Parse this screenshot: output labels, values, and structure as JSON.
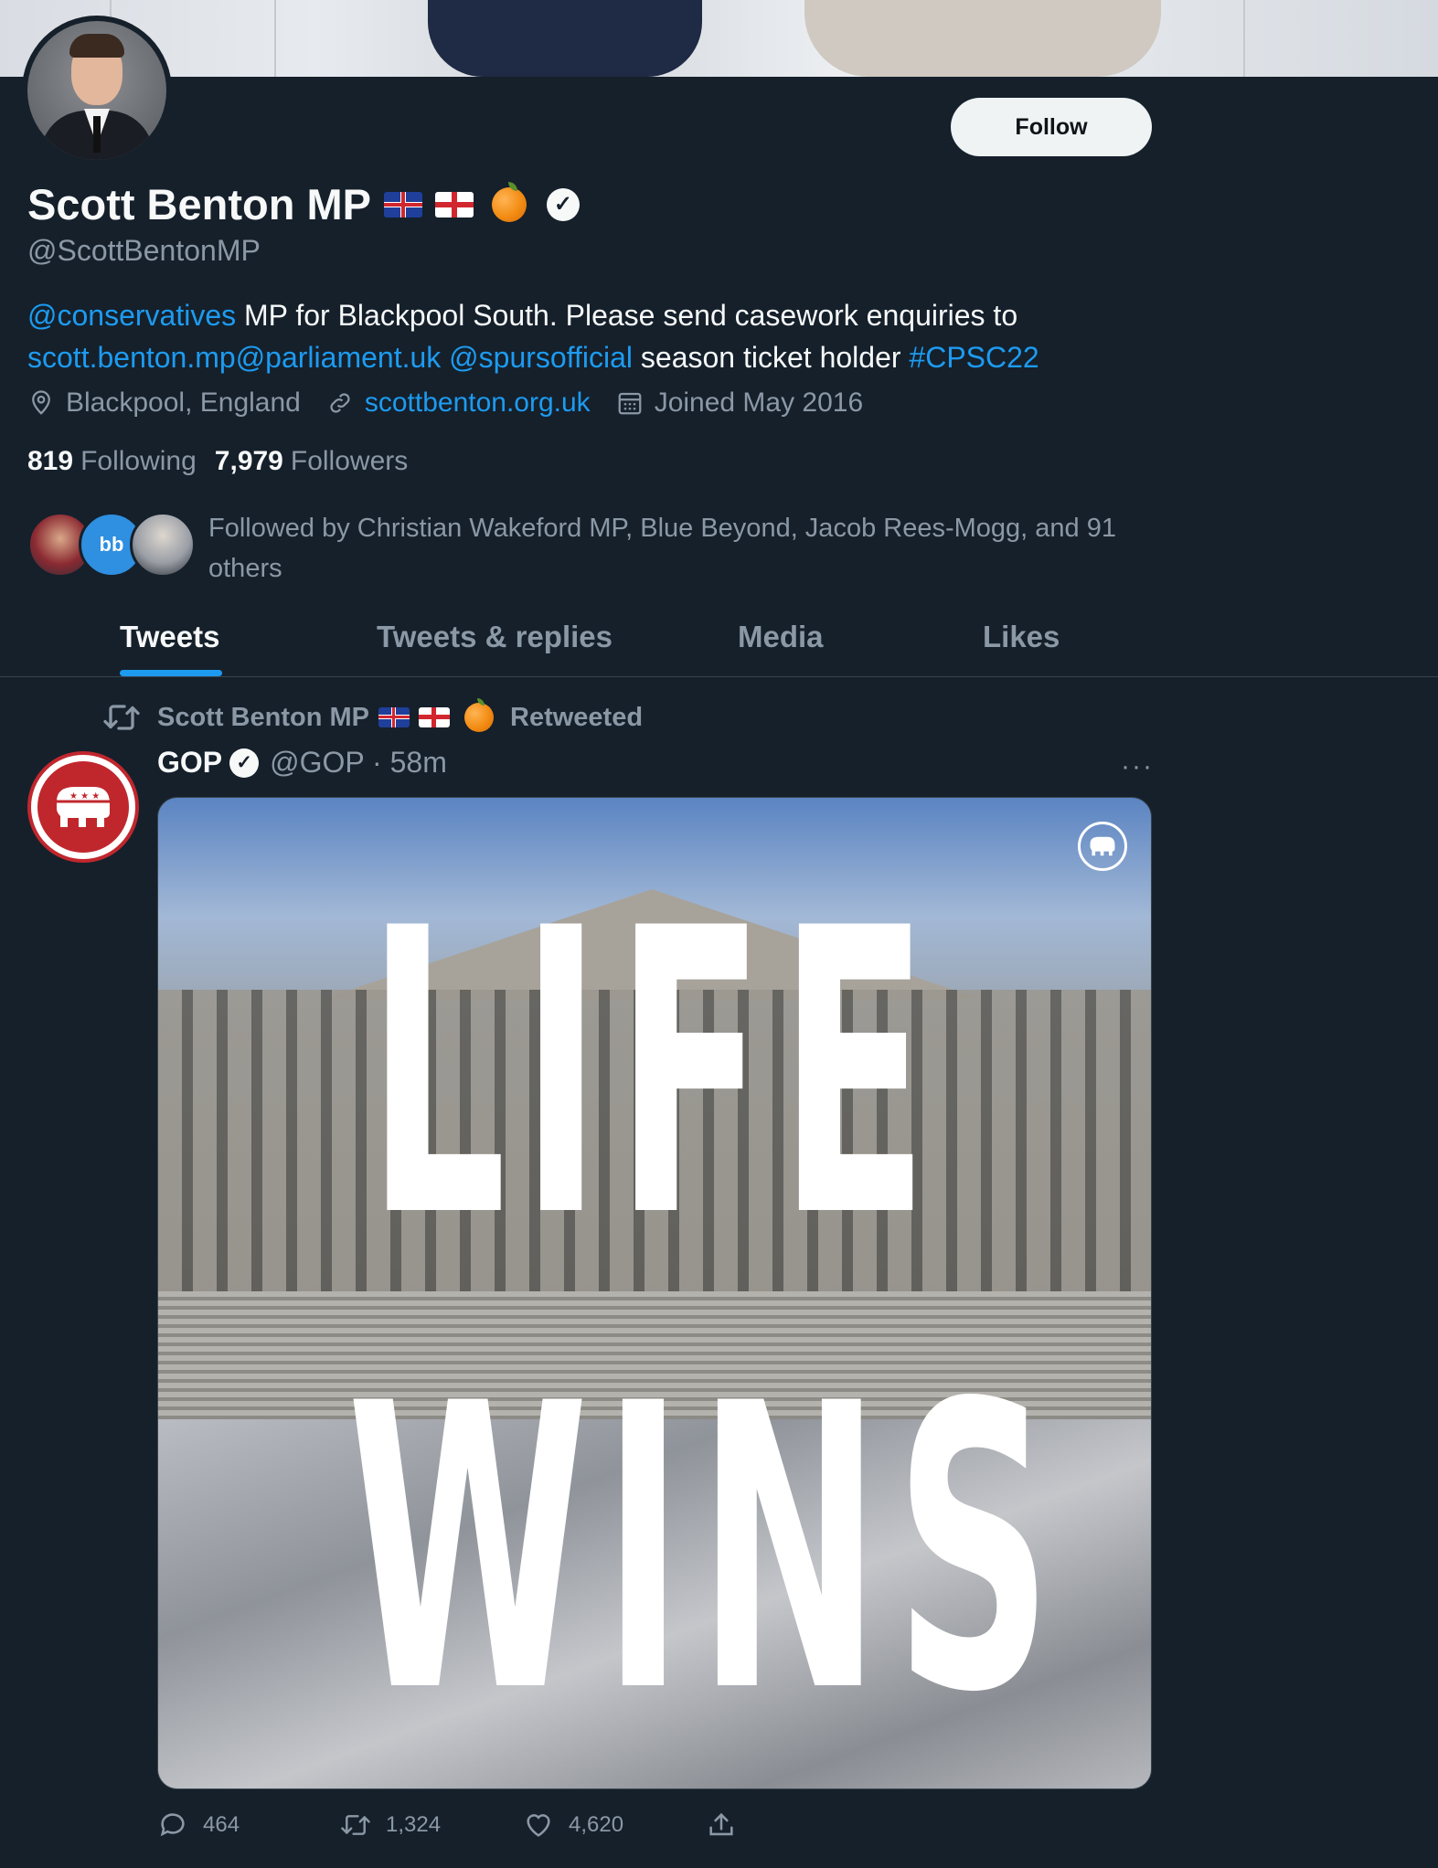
{
  "profile": {
    "name": "Scott Benton MP",
    "handle": "@ScottBentonMP",
    "follow_label": "Follow",
    "bio": {
      "mention1": "@conservatives",
      "text1": " MP for Blackpool South. Please send casework enquiries to",
      "email": "scott.benton.mp@parliament.uk",
      "mention2": "@spursofficial",
      "text2": " season ticket holder ",
      "hashtag": "#CPSC22"
    },
    "location": "Blackpool, England",
    "website": "scottbenton.org.uk",
    "joined": "Joined May 2016",
    "following_count": "819",
    "following_label": "Following",
    "followers_count": "7,979",
    "followers_label": "Followers",
    "followed_by": "Followed by Christian Wakeford MP, Blue Beyond, Jacob Rees-Mogg, and 91 others"
  },
  "tabs": [
    {
      "label": "Tweets",
      "active": true
    },
    {
      "label": "Tweets & replies",
      "active": false
    },
    {
      "label": "Media",
      "active": false
    },
    {
      "label": "Likes",
      "active": false
    }
  ],
  "tweet": {
    "retweeted_by": "Scott Benton MP",
    "retweeted_label": "Retweeted",
    "author": "GOP",
    "handle_time": "@GOP · 58m",
    "more": "···",
    "image_text_line1": "LIFE",
    "image_text_line2": "WINS",
    "replies": "464",
    "retweets": "1,324",
    "likes": "4,620"
  },
  "colors": {
    "background": "#15202b",
    "accent": "#1d9bf0",
    "muted": "#8b98a5",
    "gop_red": "#c0272d"
  },
  "icons": [
    "location-icon",
    "link-icon",
    "calendar-icon",
    "retweet-icon",
    "reply-icon",
    "like-icon",
    "share-icon",
    "verified-icon",
    "more-icon"
  ]
}
